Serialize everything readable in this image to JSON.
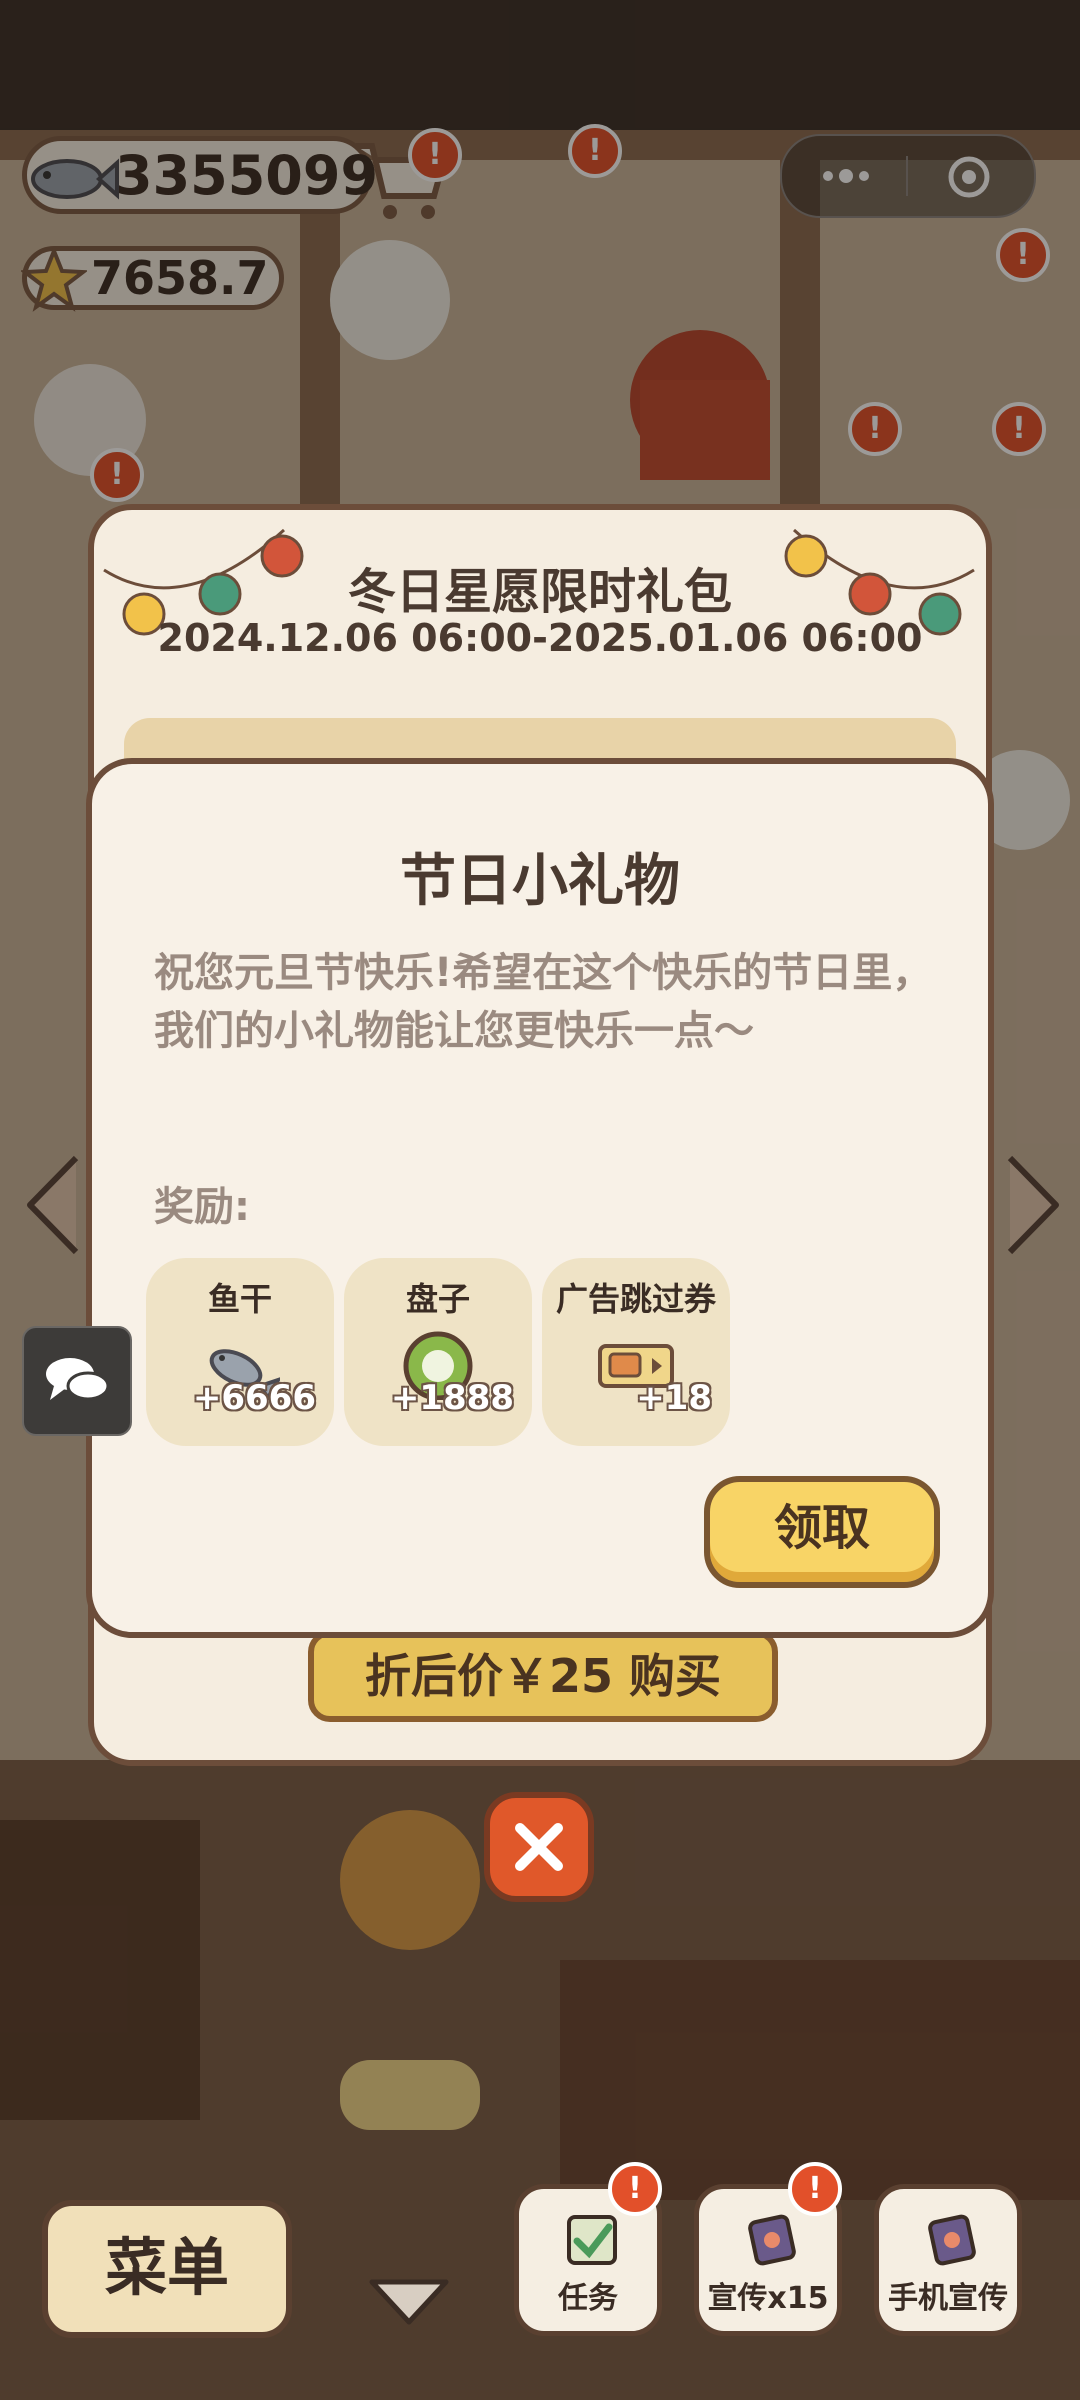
{
  "hud": {
    "fish_count": "3355099",
    "star_count": "7658.7"
  },
  "promo": {
    "title": "冬日星愿限时礼包",
    "date_range": "2024.12.06 06:00-2025.01.06 06:00",
    "buy_label": "折后价￥25 购买"
  },
  "dialog": {
    "title": "节日小礼物",
    "message": "祝您元旦节快乐!希望在这个快乐的节日里，我们的小礼物能让您更快乐一点～",
    "rewards_label": "奖励:",
    "rewards": [
      {
        "name": "鱼干",
        "count": "+6666",
        "icon": "fish-icon"
      },
      {
        "name": "盘子",
        "count": "+1888",
        "icon": "plate-icon"
      },
      {
        "name": "广告跳过券",
        "count": "+18",
        "icon": "ad-skip-ticket-icon"
      }
    ],
    "claim_label": "领取"
  },
  "nav": {
    "menu_label": "菜单",
    "tasks_label": "任务",
    "promote_label": "宣传x15",
    "phone_promote_label": "手机宣传"
  },
  "badge_text": "!",
  "colors": {
    "accent_yellow": "#f8d466",
    "badge_red": "#e2502a",
    "dialog_bg": "#f8f1e7",
    "border_brown": "#6c4d3a"
  }
}
